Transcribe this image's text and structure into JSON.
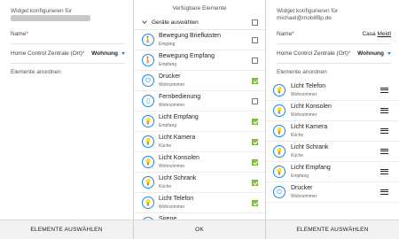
{
  "left_panel": {
    "header_line1": "Widget konfigurieren für",
    "name_label": "Name",
    "name_required": "*",
    "zentrale_label": "Home Control Zentrale (Ort)",
    "zentrale_required": "*",
    "zentrale_value": "Wohnung",
    "section_label": "Elemente anordnen",
    "footer_button": "ELEMENTE AUSWÄHLEN"
  },
  "middle_panel": {
    "title": "Verfügbare Elemente",
    "select_all_label": "Geräte auswählen",
    "items": [
      {
        "name": "Bewegung Briefkasten",
        "room": "Eingang",
        "icon": "motion-icon",
        "glyph": "🚶",
        "checked": false
      },
      {
        "name": "Bewegung Empfang",
        "room": "Empfang",
        "icon": "motion-icon",
        "glyph": "🚶",
        "checked": false
      },
      {
        "name": "Drucker",
        "room": "Wohnzimmer",
        "icon": "plug-icon",
        "glyph": "⏻",
        "checked": true
      },
      {
        "name": "Fernbedienung",
        "room": "Wohnzimmer",
        "icon": "remote-icon",
        "glyph": "▯",
        "checked": false
      },
      {
        "name": "Licht Empfang",
        "room": "Empfang",
        "icon": "bulb-icon",
        "glyph": "💡",
        "checked": true
      },
      {
        "name": "Licht Kamera",
        "room": "Küche",
        "icon": "bulb-icon",
        "glyph": "💡",
        "checked": true
      },
      {
        "name": "Licht Konsolen",
        "room": "Wohnzimmer",
        "icon": "bulb-icon",
        "glyph": "💡",
        "checked": true
      },
      {
        "name": "Licht Schrank",
        "room": "Küche",
        "icon": "bulb-icon",
        "glyph": "💡",
        "checked": true
      },
      {
        "name": "Licht Telefon",
        "room": "Wohnzimmer",
        "icon": "bulb-icon",
        "glyph": "💡",
        "checked": true
      },
      {
        "name": "Sirene",
        "room": "",
        "icon": "siren-icon",
        "glyph": "◉",
        "checked": false
      }
    ],
    "footer_button": "OK"
  },
  "right_panel": {
    "header_line1": "Widget konfigurieren für",
    "header_email": "michael@mobilflip.de",
    "name_label": "Name",
    "name_required": "*",
    "name_value_prefix": "Casa ",
    "name_value_underlined": "Meidl",
    "zentrale_label": "Home Control Zentrale (Ort)",
    "zentrale_required": "*",
    "zentrale_value": "Wohnung",
    "section_label": "Elemente anordnen",
    "items": [
      {
        "name": "Licht Telefon",
        "room": "Wohnzimmer",
        "icon": "bulb-icon",
        "glyph": "💡"
      },
      {
        "name": "Licht Konsolen",
        "room": "Wohnzimmer",
        "icon": "bulb-icon",
        "glyph": "💡"
      },
      {
        "name": "Licht Kamera",
        "room": "Küche",
        "icon": "bulb-icon",
        "glyph": "💡"
      },
      {
        "name": "Licht Schrank",
        "room": "Küche",
        "icon": "bulb-icon",
        "glyph": "💡"
      },
      {
        "name": "Licht Empfang",
        "room": "Empfang",
        "icon": "bulb-icon",
        "glyph": "💡"
      },
      {
        "name": "Drucker",
        "room": "Wohnzimmer",
        "icon": "plug-icon",
        "glyph": "⏻"
      }
    ],
    "footer_button": "ELEMENTE AUSWÄHLEN"
  },
  "colors": {
    "accent": "#1e88e5",
    "check": "#8bc34a",
    "required": "#dd3333"
  }
}
